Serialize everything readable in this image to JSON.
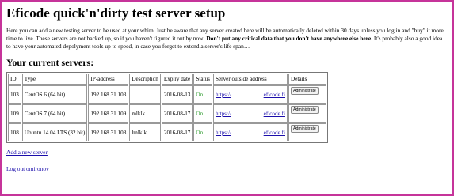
{
  "page": {
    "title": "Eficode quick'n'dirty test server setup",
    "intro_normal_1": "Here you can add a new testing server to be used at your whim. Just be aware that any server created here will be automatically deleted within 30 days unless you log in and \"buy\" it more time to live. These servers are not backed up, so if you haven't figured it out by now: ",
    "intro_bold": "Don't put any critical data that you don't have anywhere else here.",
    "intro_normal_2": " It's probably also a good idea to have your automated depolyment tools up to speed, in case you forget to extend a server's life span…",
    "servers_heading": "Your current servers:"
  },
  "table": {
    "headers": [
      "ID",
      "Type",
      "IP-address",
      "Description",
      "Expiry date",
      "Status",
      "Server outside address",
      "Details"
    ],
    "rows": [
      {
        "id": "103",
        "type": "CentOS 6 (64 bit)",
        "ip": "192.168.31.103",
        "description": "",
        "expiry": "2016-08-13",
        "status": "On",
        "addr_left": "https://",
        "addr_right": "eficode.fi",
        "details_button": "Administrate"
      },
      {
        "id": "109",
        "type": "CentOS 7 (64 bit)",
        "ip": "192.168.31.109",
        "description": "mlklk",
        "expiry": "2016-08-17",
        "status": "On",
        "addr_left": "https://",
        "addr_right": "eficode.fi",
        "details_button": "Administrate"
      },
      {
        "id": "108",
        "type": "Ubuntu 14.04 LTS (32 bit)",
        "ip": "192.168.31.108",
        "description": "lmlklk",
        "expiry": "2016-08-17",
        "status": "On",
        "addr_left": "https://",
        "addr_right": "eficode.fi",
        "details_button": "Administrate"
      }
    ]
  },
  "links": {
    "add_server": "Add a new server",
    "logout": "Log out omironov"
  },
  "colors": {
    "frame_border": "#c6349a",
    "status_on": "#2b9b2b",
    "link": "#1a0dab"
  }
}
